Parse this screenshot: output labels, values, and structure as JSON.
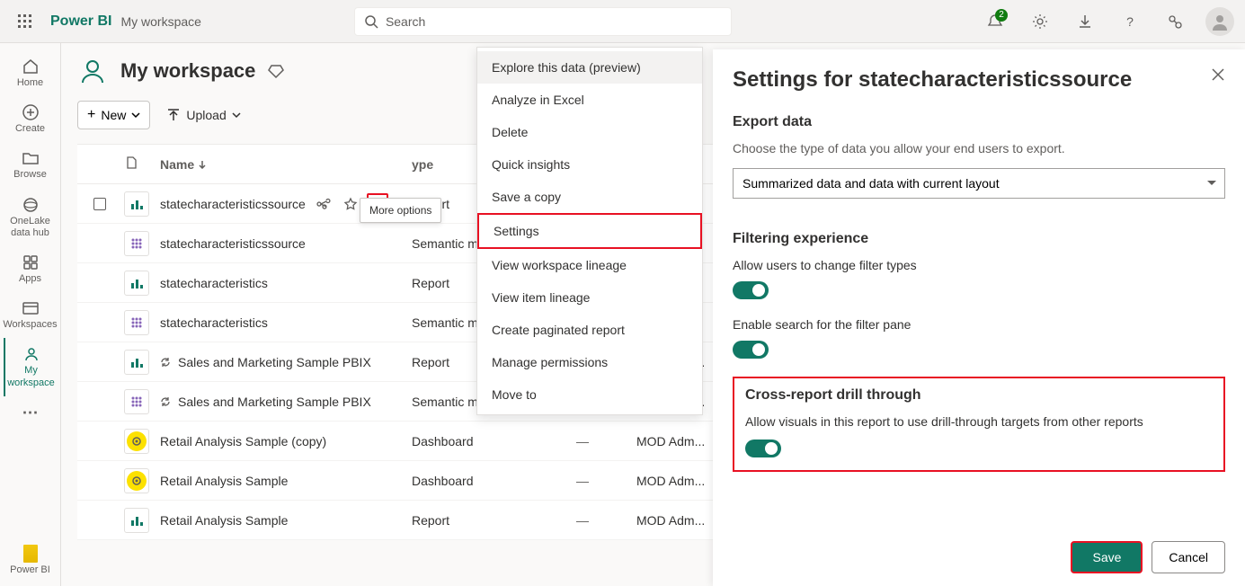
{
  "header": {
    "brand": "Power BI",
    "breadcrumb": "My workspace",
    "search_placeholder": "Search",
    "notification_count": "2"
  },
  "nav": {
    "home": "Home",
    "create": "Create",
    "browse": "Browse",
    "onelake": "OneLake data hub",
    "apps": "Apps",
    "workspaces": "Workspaces",
    "my_workspace": "My workspace",
    "footer": "Power BI"
  },
  "workspace": {
    "title": "My workspace",
    "new_label": "New",
    "upload_label": "Upload"
  },
  "table": {
    "col_name": "Name",
    "col_type": "Type",
    "dash": "—",
    "rows": [
      {
        "name": "statecharacteristicssource",
        "type": "Report",
        "owner": ""
      },
      {
        "name": "statecharacteristicssource",
        "type": "Semantic model",
        "owner": ""
      },
      {
        "name": "statecharacteristics",
        "type": "Report",
        "owner": ""
      },
      {
        "name": "statecharacteristics",
        "type": "Semantic model",
        "owner": ""
      },
      {
        "name": "Sales and Marketing Sample PBIX",
        "type": "Report",
        "owner": "MOD Adm..."
      },
      {
        "name": "Sales and Marketing Sample PBIX",
        "type": "Semantic model",
        "owner": "MOD Adm..."
      },
      {
        "name": "Retail Analysis Sample (copy)",
        "type": "Dashboard",
        "owner": "MOD Adm..."
      },
      {
        "name": "Retail Analysis Sample",
        "type": "Dashboard",
        "owner": "MOD Adm..."
      },
      {
        "name": "Retail Analysis Sample",
        "type": "Report",
        "owner": "MOD Adm..."
      }
    ]
  },
  "tooltip": {
    "more": "More options"
  },
  "menu": {
    "explore": "Explore this data (preview)",
    "analyze": "Analyze in Excel",
    "delete": "Delete",
    "quick": "Quick insights",
    "save_copy": "Save a copy",
    "settings": "Settings",
    "ws_lineage": "View workspace lineage",
    "item_lineage": "View item lineage",
    "paginated": "Create paginated report",
    "permissions": "Manage permissions",
    "move": "Move to"
  },
  "panel": {
    "title": "Settings for statecharacteristicssource",
    "export_heading": "Export data",
    "export_desc": "Choose the type of data you allow your end users to export.",
    "export_selected": "Summarized data and data with current layout",
    "filter_heading": "Filtering experience",
    "filter_types": "Allow users to change filter types",
    "filter_search": "Enable search for the filter pane",
    "cross_heading": "Cross-report drill through",
    "cross_desc": "Allow visuals in this report to use drill-through targets from other reports",
    "save": "Save",
    "cancel": "Cancel"
  }
}
